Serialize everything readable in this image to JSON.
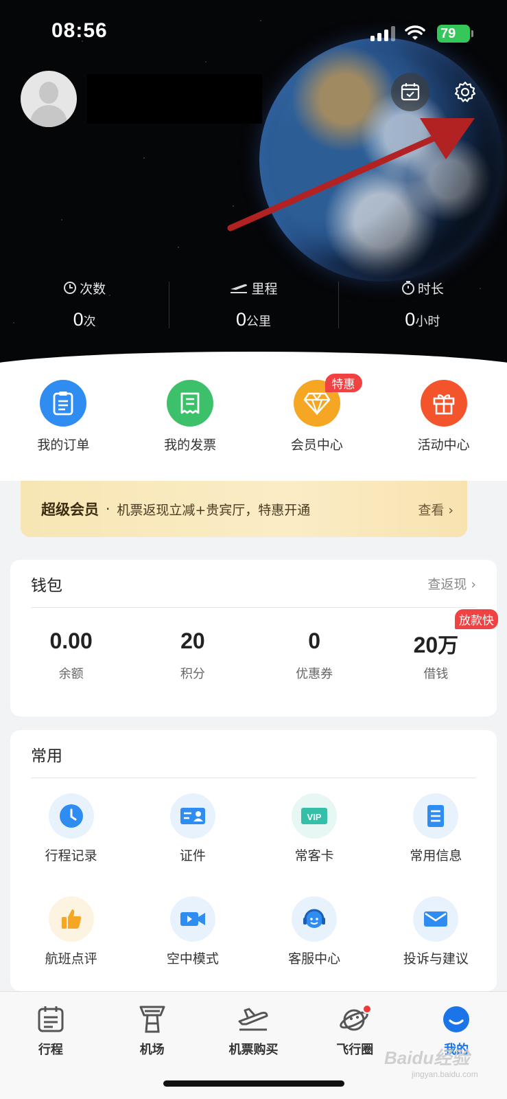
{
  "status_bar": {
    "time": "08:56",
    "battery": "79"
  },
  "hero": {
    "stats": [
      {
        "label": "次数",
        "value": "0",
        "unit": "次",
        "icon": "clock-icon"
      },
      {
        "label": "里程",
        "value": "0",
        "unit": "公里",
        "icon": "plane-takeoff-icon"
      },
      {
        "label": "时长",
        "value": "0",
        "unit": "小时",
        "icon": "stopwatch-icon"
      }
    ]
  },
  "quick_actions": [
    {
      "label": "我的订单",
      "icon": "order-clipboard-icon",
      "color": "#2f8cf0"
    },
    {
      "label": "我的发票",
      "icon": "invoice-icon",
      "color": "#3cc06a"
    },
    {
      "label": "会员中心",
      "icon": "diamond-icon",
      "color": "#f5a623",
      "badge": "特惠"
    },
    {
      "label": "活动中心",
      "icon": "gift-icon",
      "color": "#f4542c"
    }
  ],
  "super_member": {
    "title": "超级会员",
    "dot": "·",
    "description": "机票返现立减+贵宾厅，特惠开通",
    "link": "查看 ›"
  },
  "wallet": {
    "title": "钱包",
    "link": "查返现 ›",
    "items": [
      {
        "value": "0.00",
        "label": "余额"
      },
      {
        "value": "20",
        "label": "积分"
      },
      {
        "value": "0",
        "label": "优惠券"
      },
      {
        "value": "20",
        "value_suffix": "万",
        "label": "借钱",
        "badge": "放款快"
      }
    ]
  },
  "common": {
    "title": "常用",
    "items": [
      {
        "label": "行程记录",
        "icon": "clock-icon"
      },
      {
        "label": "证件",
        "icon": "id-card-icon"
      },
      {
        "label": "常客卡",
        "icon": "vip-card-icon"
      },
      {
        "label": "常用信息",
        "icon": "document-icon"
      },
      {
        "label": "航班点评",
        "icon": "thumbs-up-icon"
      },
      {
        "label": "空中模式",
        "icon": "video-camera-icon"
      },
      {
        "label": "客服中心",
        "icon": "headset-icon"
      },
      {
        "label": "投诉与建议",
        "icon": "mail-icon"
      }
    ]
  },
  "tabbar": {
    "tabs": [
      {
        "label": "行程",
        "icon": "itinerary-icon"
      },
      {
        "label": "机场",
        "icon": "airport-tower-icon"
      },
      {
        "label": "机票购买",
        "icon": "plane-ticket-icon"
      },
      {
        "label": "飞行圈",
        "icon": "planet-icon",
        "dot": true
      },
      {
        "label": "我的",
        "icon": "profile-smile-icon",
        "active": true
      }
    ]
  },
  "watermark": {
    "brand": "Baidu经验",
    "url": "jingyan.baidu.com"
  }
}
